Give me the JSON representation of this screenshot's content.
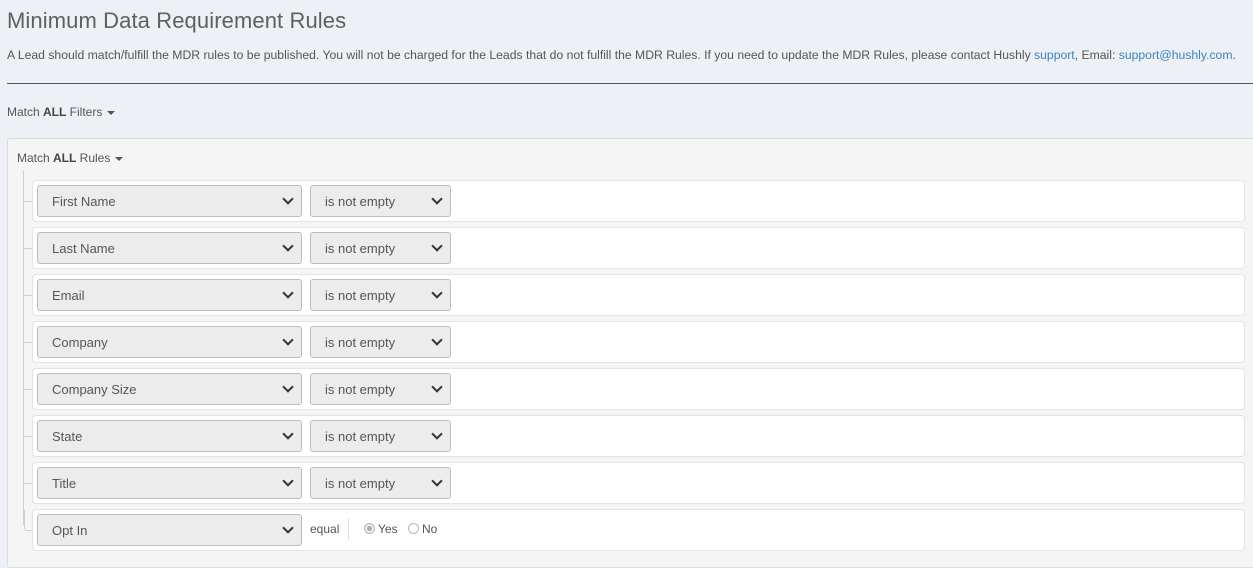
{
  "header": {
    "title": "Minimum Data Requirement Rules",
    "description_prefix": "A Lead should match/fulfill the MDR rules to be published. You will not be charged for the Leads that do not fulfill the MDR Rules. If you need to update the MDR Rules, please contact Hushly ",
    "support_link": "support",
    "email_sep": ", Email: ",
    "email_link": "support@hushly.com",
    "suffix": "."
  },
  "filters": {
    "prefix": "Match ",
    "mode": "ALL",
    "suffix": " Filters"
  },
  "rules_group": {
    "prefix": "Match ",
    "mode": "ALL",
    "suffix": " Rules",
    "rules": [
      {
        "field": "First Name",
        "operator": "is not empty"
      },
      {
        "field": "Last Name",
        "operator": "is not empty"
      },
      {
        "field": "Email",
        "operator": "is not empty"
      },
      {
        "field": "Company",
        "operator": "is not empty"
      },
      {
        "field": "Company Size",
        "operator": "is not empty"
      },
      {
        "field": "State",
        "operator": "is not empty"
      },
      {
        "field": "Title",
        "operator": "is not empty"
      }
    ],
    "opt_in": {
      "field": "Opt In",
      "operator": "equal",
      "options": [
        "Yes",
        "No"
      ],
      "selected": "Yes"
    }
  },
  "colors": {
    "background": "#edf0f5",
    "link": "#3a83c2",
    "select_bg": "#ececec"
  }
}
